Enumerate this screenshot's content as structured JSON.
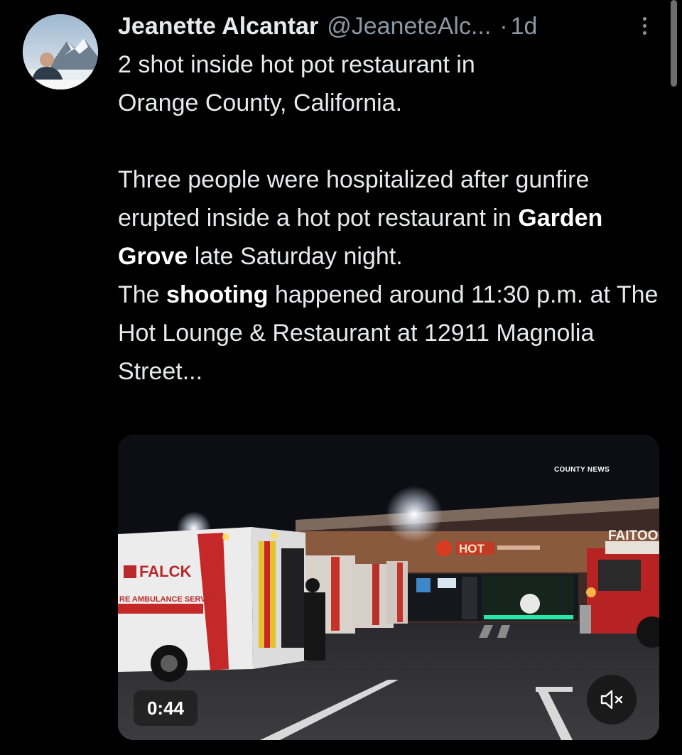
{
  "author": {
    "name": "Jeanette Alcantar",
    "handle": "@JeaneteAlc...",
    "separator": "·",
    "time": "1d",
    "avatar_icon": "profile-photo-avatar"
  },
  "post": {
    "line1": "2 shot inside hot pot restaurant in",
    "line2": "Orange County, California.",
    "p2_part1": "Three people were hospitalized after gunfire erupted inside a hot pot restaurant in ",
    "p2_bold": "Garden Grove",
    "p2_part2": " late Saturday night.",
    "p3_part1": "The ",
    "p3_bold": "shooting",
    "p3_part2": " happened around 11:30 p.m. at The Hot Lounge & Restaurant at 12911 Magnolia Street..."
  },
  "media": {
    "type": "video",
    "watermark": "COUNTY NEWS",
    "duration": "0:44",
    "mute_icon": "speaker-muted-icon",
    "scene_text": {
      "ambulance_brand": "FALCK",
      "ambulance_service": "RE AMBULANCE SERVICE",
      "restaurant_sign": "HOT",
      "store_sign": "FAITOO"
    }
  },
  "colors": {
    "background": "#000000",
    "text_primary": "#e7e9ea",
    "text_secondary": "#8b98a5"
  }
}
